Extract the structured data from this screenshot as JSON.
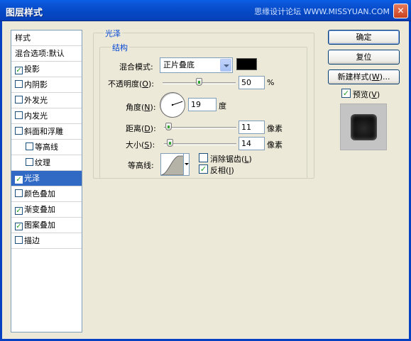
{
  "window": {
    "title": "图层样式",
    "watermark": "思缘设计论坛 WWW.MISSYUAN.COM",
    "close_glyph": "✕"
  },
  "style_list": {
    "items": [
      {
        "label": "样式",
        "checkbox": false,
        "checked": false,
        "indent": false,
        "selected": false
      },
      {
        "label": "混合选项:默认",
        "checkbox": false,
        "checked": false,
        "indent": false,
        "selected": false
      },
      {
        "label": "投影",
        "checkbox": true,
        "checked": true,
        "indent": false,
        "selected": false
      },
      {
        "label": "内阴影",
        "checkbox": true,
        "checked": false,
        "indent": false,
        "selected": false
      },
      {
        "label": "外发光",
        "checkbox": true,
        "checked": false,
        "indent": false,
        "selected": false
      },
      {
        "label": "内发光",
        "checkbox": true,
        "checked": false,
        "indent": false,
        "selected": false
      },
      {
        "label": "斜面和浮雕",
        "checkbox": true,
        "checked": false,
        "indent": false,
        "selected": false
      },
      {
        "label": "等高线",
        "checkbox": true,
        "checked": false,
        "indent": true,
        "selected": false
      },
      {
        "label": "纹理",
        "checkbox": true,
        "checked": false,
        "indent": true,
        "selected": false
      },
      {
        "label": "光泽",
        "checkbox": true,
        "checked": true,
        "indent": false,
        "selected": true
      },
      {
        "label": "颜色叠加",
        "checkbox": true,
        "checked": false,
        "indent": false,
        "selected": false
      },
      {
        "label": "渐变叠加",
        "checkbox": true,
        "checked": true,
        "indent": false,
        "selected": false
      },
      {
        "label": "图案叠加",
        "checkbox": true,
        "checked": true,
        "indent": false,
        "selected": false
      },
      {
        "label": "描边",
        "checkbox": true,
        "checked": false,
        "indent": false,
        "selected": false
      }
    ]
  },
  "panel": {
    "group_title": "光泽",
    "subgroup_title": "结构",
    "blend_mode_label": "混合模式:",
    "blend_mode_value": "正片叠底",
    "blend_color": "#000000",
    "opacity_label_pre": "不透明度(",
    "opacity_key": "O",
    "opacity_label_post": "):",
    "opacity_value": "50",
    "opacity_fraction": 0.5,
    "opacity_unit": "%",
    "angle_label_pre": "角度(",
    "angle_key": "N",
    "angle_label_post": "):",
    "angle_value": "19",
    "angle_unit": "度",
    "distance_label_pre": "距离(",
    "distance_key": "D",
    "distance_label_post": "):",
    "distance_value": "11",
    "distance_unit": "像素",
    "size_label_pre": "大小(",
    "size_key": "S",
    "size_label_post": "):",
    "size_value": "14",
    "size_unit": "像素",
    "contour_label": "等高线:",
    "antialias_label_pre": "消除锯齿(",
    "antialias_key": "L",
    "antialias_label_post": ")",
    "antialias_checked": false,
    "invert_label_pre": "反相(",
    "invert_key": "I",
    "invert_label_post": ")",
    "invert_checked": true
  },
  "buttons": {
    "ok": "确定",
    "reset": "复位",
    "new_style_pre": "新建样式(",
    "new_style_key": "W",
    "new_style_post": ")..."
  },
  "preview": {
    "label_pre": "预览(",
    "label_key": "V",
    "label_post": ")",
    "checked": true
  },
  "check_glyph": "✓"
}
